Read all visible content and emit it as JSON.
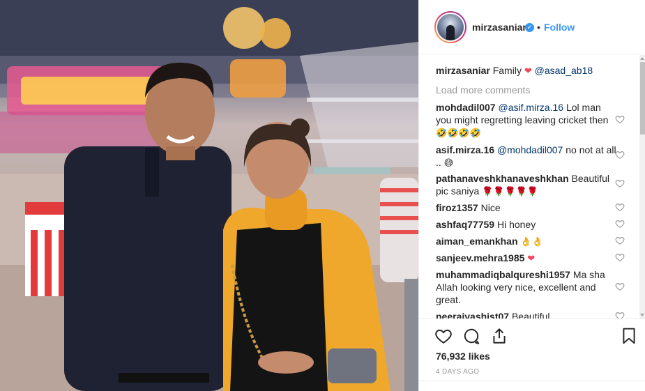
{
  "post": {
    "author": "mirzasaniar",
    "verified_icon": "verified-badge-icon",
    "separator": "•",
    "follow_label": "Follow",
    "caption_user": "mirzasaniar",
    "caption_text": "Family",
    "caption_mention": "@asad_ab18",
    "load_more_label": "Load more comments",
    "likes": "76,932 likes",
    "time_ago": "4 DAYS AGO"
  },
  "comments": [
    {
      "user": "mohdadil007",
      "mention": "@asif.mirza.16",
      "text": "Lol man you might regretting leaving cricket then",
      "emoji": "🤣🤣🤣🤣"
    },
    {
      "user": "asif.mirza.16",
      "mention": "@mohdadil007",
      "text": "no not at all ..",
      "emoji": "😅"
    },
    {
      "user": "pathanaveshkhanaveshkhan",
      "mention": "",
      "text": "Beautiful pic saniya",
      "emoji": "🌹🌹🌹🌹🌹"
    },
    {
      "user": "firoz1357",
      "mention": "",
      "text": "Nice",
      "emoji": ""
    },
    {
      "user": "ashfaq77759",
      "mention": "",
      "text": "Hi honey",
      "emoji": ""
    },
    {
      "user": "aiman_emankhan",
      "mention": "",
      "text": "",
      "emoji": "👌👌"
    },
    {
      "user": "sanjeev.mehra1985",
      "mention": "",
      "text": "",
      "emoji": "❤"
    },
    {
      "user": "muhammadiqbalqureshi1957",
      "mention": "",
      "text": "Ma sha Allah looking very nice, excellent and great.",
      "emoji": ""
    },
    {
      "user": "neerajvashist07",
      "mention": "",
      "text": "Beautiful",
      "emoji": ""
    }
  ],
  "colors": {
    "link": "#3897f0",
    "heart": "#ed4956",
    "muted": "#999999"
  },
  "icons": [
    "like-icon",
    "comment-icon",
    "share-icon",
    "bookmark-icon"
  ]
}
